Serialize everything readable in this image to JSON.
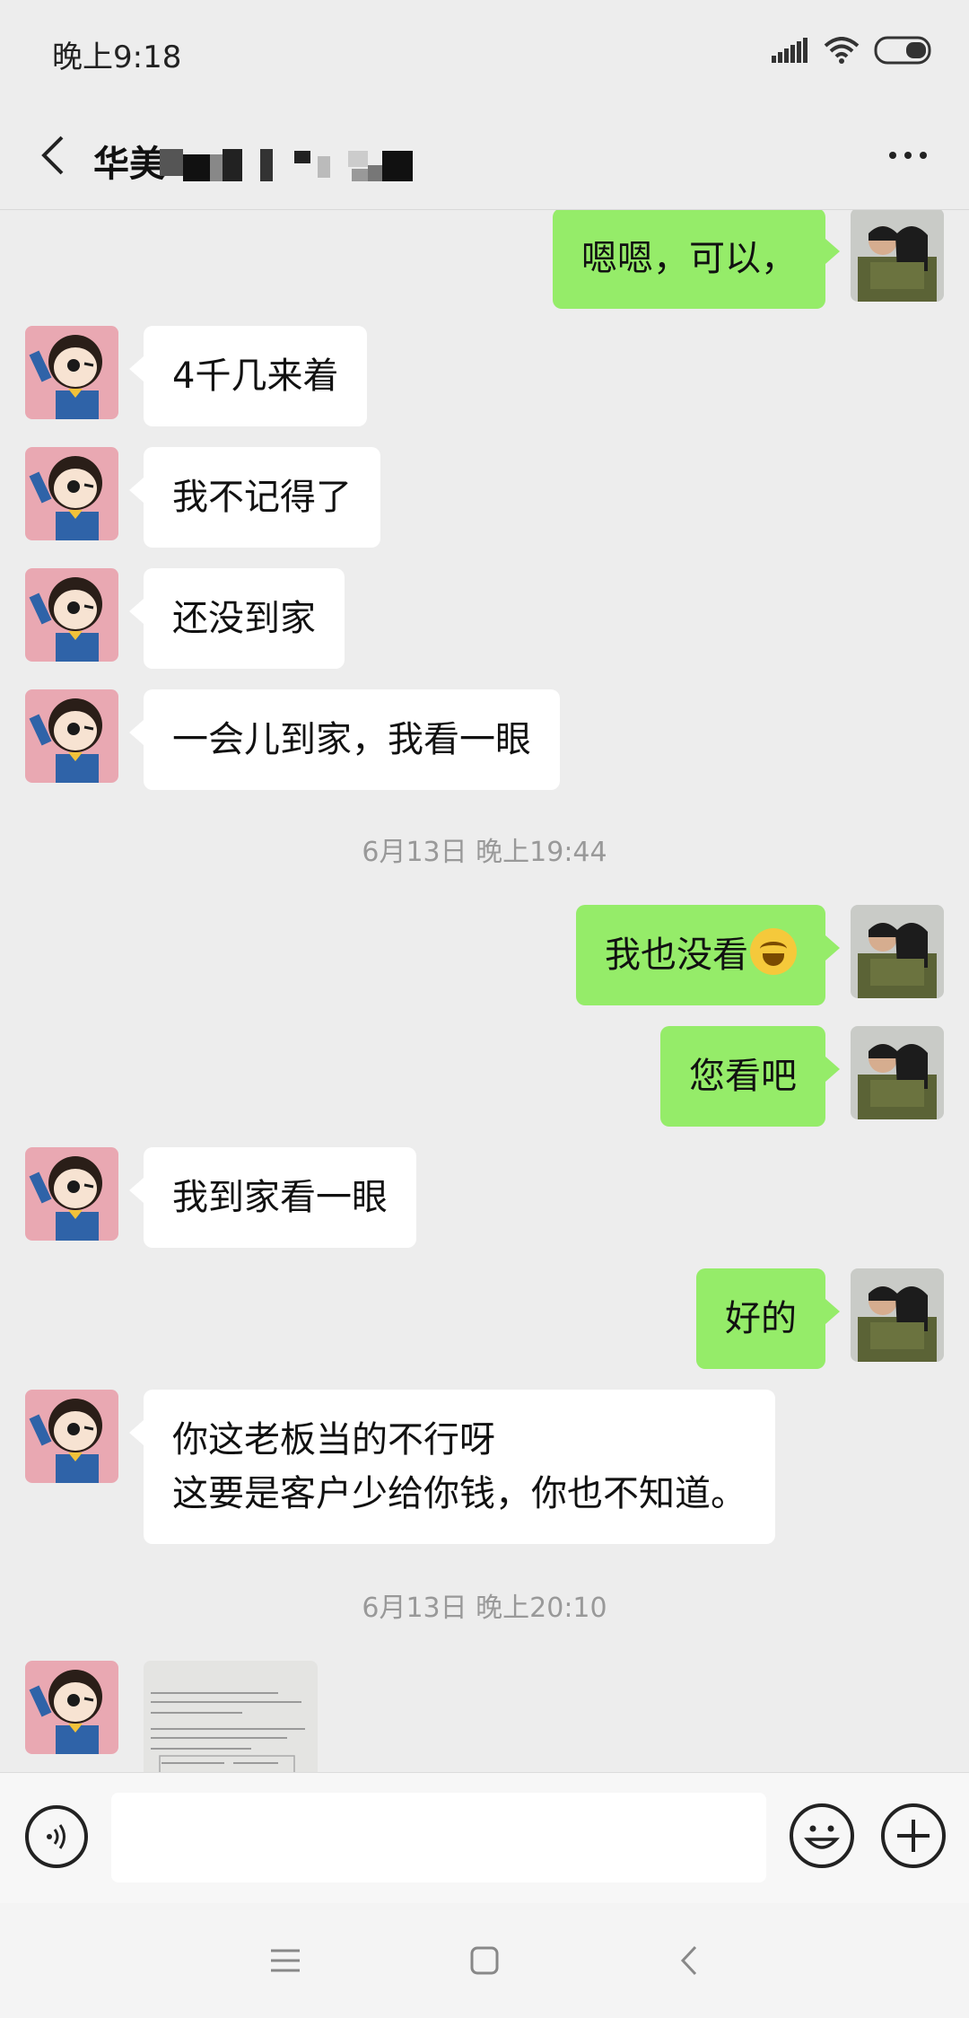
{
  "status_bar": {
    "time": "晚上9:18"
  },
  "nav": {
    "title": "华美"
  },
  "messages": [
    {
      "side": "right",
      "text": "嗯嗯，可以，"
    },
    {
      "side": "left",
      "text": "4千几来着"
    },
    {
      "side": "left",
      "text": "我不记得了"
    },
    {
      "side": "left",
      "text": "还没到家"
    },
    {
      "side": "left",
      "text": "一会儿到家，我看一眼"
    },
    {
      "type": "timestamp",
      "text": "6月13日 晚上19:44"
    },
    {
      "side": "right",
      "text": "我也没看",
      "emoji": "facepalm-laugh"
    },
    {
      "side": "right",
      "text": "您看吧"
    },
    {
      "side": "left",
      "text": "我到家看一眼"
    },
    {
      "side": "right",
      "text": "好的"
    },
    {
      "side": "left",
      "text": "你这老板当的不行呀\n这要是客户少给你钱，你也不知道。"
    },
    {
      "type": "timestamp",
      "text": "6月13日 晚上20:10"
    },
    {
      "side": "left",
      "type": "image",
      "icon": "photo-thumbnail"
    }
  ],
  "input": {
    "placeholder": "",
    "value": ""
  },
  "colors": {
    "background": "#ededed",
    "sent_bubble": "#95ec69",
    "received_bubble": "#ffffff",
    "timestamp": "#999999"
  }
}
